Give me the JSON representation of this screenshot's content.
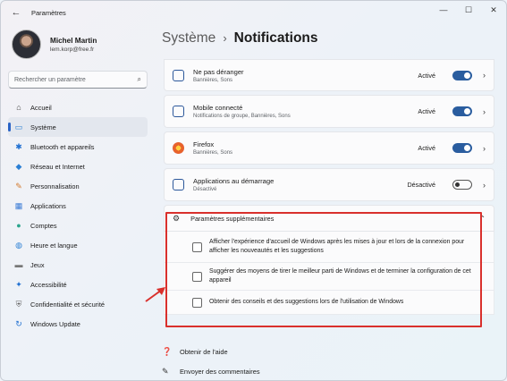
{
  "window": {
    "title": "Paramètres",
    "back_icon": "←",
    "minimize_icon": "—",
    "maximize_icon": "☐",
    "close_icon": "✕"
  },
  "profile": {
    "name": "Michel Martin",
    "email": "lem.korp@free.fr"
  },
  "search": {
    "placeholder": "Rechercher un paramètre",
    "icon": "⌕"
  },
  "sidebar": {
    "items": [
      {
        "label": "Accueil",
        "icon": "home-icon",
        "glyph": "⌂",
        "color": "#444444",
        "selected": false
      },
      {
        "label": "Système",
        "icon": "system-icon",
        "glyph": "▭",
        "color": "#2a7fd4",
        "selected": true
      },
      {
        "label": "Bluetooth et appareils",
        "icon": "bluetooth-icon",
        "glyph": "✱",
        "color": "#1f6fd1",
        "selected": false
      },
      {
        "label": "Réseau et Internet",
        "icon": "network-icon",
        "glyph": "◆",
        "color": "#2a7fd4",
        "selected": false
      },
      {
        "label": "Personnalisation",
        "icon": "brush-icon",
        "glyph": "✎",
        "color": "#d27a2c",
        "selected": false
      },
      {
        "label": "Applications",
        "icon": "apps-icon",
        "glyph": "▦",
        "color": "#3a7bd5",
        "selected": false
      },
      {
        "label": "Comptes",
        "icon": "accounts-icon",
        "glyph": "●",
        "color": "#2ca58d",
        "selected": false
      },
      {
        "label": "Heure et langue",
        "icon": "globe-icon",
        "glyph": "◍",
        "color": "#2a7fd4",
        "selected": false
      },
      {
        "label": "Jeux",
        "icon": "gamepad-icon",
        "glyph": "▬",
        "color": "#777777",
        "selected": false
      },
      {
        "label": "Accessibilité",
        "icon": "accessibility-icon",
        "glyph": "✦",
        "color": "#1f6fd1",
        "selected": false
      },
      {
        "label": "Confidentialité et sécurité",
        "icon": "shield-icon",
        "glyph": "⛨",
        "color": "#666666",
        "selected": false
      },
      {
        "label": "Windows Update",
        "icon": "update-icon",
        "glyph": "↻",
        "color": "#1f6fd1",
        "selected": false
      }
    ]
  },
  "breadcrumb": {
    "parent": "Système",
    "separator": "›",
    "current": "Notifications"
  },
  "apps": [
    {
      "title": "Ne pas déranger",
      "subtitle": "Bannières, Sons",
      "state": "Activé",
      "on": true,
      "icon": "app-tile-icon",
      "icon_color": "#2b579a"
    },
    {
      "title": "Mobile connecté",
      "subtitle": "Notifications de groupe, Bannières, Sons",
      "state": "Activé",
      "on": true,
      "icon": "phone-link-icon",
      "icon_color": "#2b579a"
    },
    {
      "title": "Firefox",
      "subtitle": "Bannières, Sons",
      "state": "Activé",
      "on": true,
      "icon": "firefox-icon",
      "icon_color": "#e8632b"
    },
    {
      "title": "Applications au démarrage",
      "subtitle": "Désactivé",
      "state": "Désactivé",
      "on": false,
      "icon": "startup-apps-icon",
      "icon_color": "#2b579a"
    }
  ],
  "additional": {
    "title": "Paramètres supplémentaires",
    "options": [
      {
        "label": "Afficher l'expérience d'accueil de Windows après les mises à jour et lors de la connexion pour afficher les nouveautés et les suggestions",
        "checked": false
      },
      {
        "label": "Suggérer des moyens de tirer le meilleur parti de Windows et de terminer la configuration de cet appareil",
        "checked": false
      },
      {
        "label": "Obtenir des conseils et des suggestions lors de l'utilisation de Windows",
        "checked": false
      }
    ]
  },
  "links": {
    "help": "Obtenir de l'aide",
    "feedback": "Envoyer des commentaires"
  },
  "colors": {
    "accent": "#2a5d9f",
    "annotation": "#d9302c"
  }
}
